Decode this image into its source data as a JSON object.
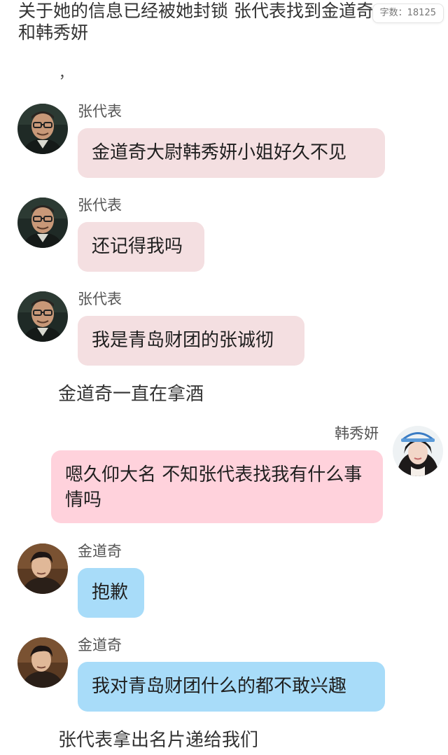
{
  "header": {
    "line1": "关于她的信息已经被她封锁 张代表找到金道奇",
    "line2": "和韩秀妍",
    "mark": "，"
  },
  "word_count": {
    "label": "字数：18125"
  },
  "messages": [
    {
      "speaker": "张代表",
      "text": "金道奇大尉韩秀妍小姐好久不见"
    },
    {
      "speaker": "张代表",
      "text": "还记得我吗"
    },
    {
      "speaker": "张代表",
      "text": "我是青岛财团的张诚彻"
    },
    {
      "speaker": "韩秀妍",
      "text": "嗯久仰大名 不知张代表找我有什么事情吗"
    },
    {
      "speaker": "金道奇",
      "text": "抱歉"
    },
    {
      "speaker": "金道奇",
      "text": "我对青岛财团什么的都不敢兴趣"
    }
  ],
  "narration": [
    "金道奇一直在拿酒",
    "张代表拿出名片递给我们"
  ],
  "colors": {
    "zhang_bubble": "#f4dfe1",
    "han_bubble": "#ffd2dc",
    "kim_bubble": "#a8dcf9"
  },
  "icons": {
    "zhang_avatar": "man-with-glasses-avatar",
    "han_avatar": "woman-with-cap-avatar",
    "kim_avatar": "young-man-avatar"
  }
}
